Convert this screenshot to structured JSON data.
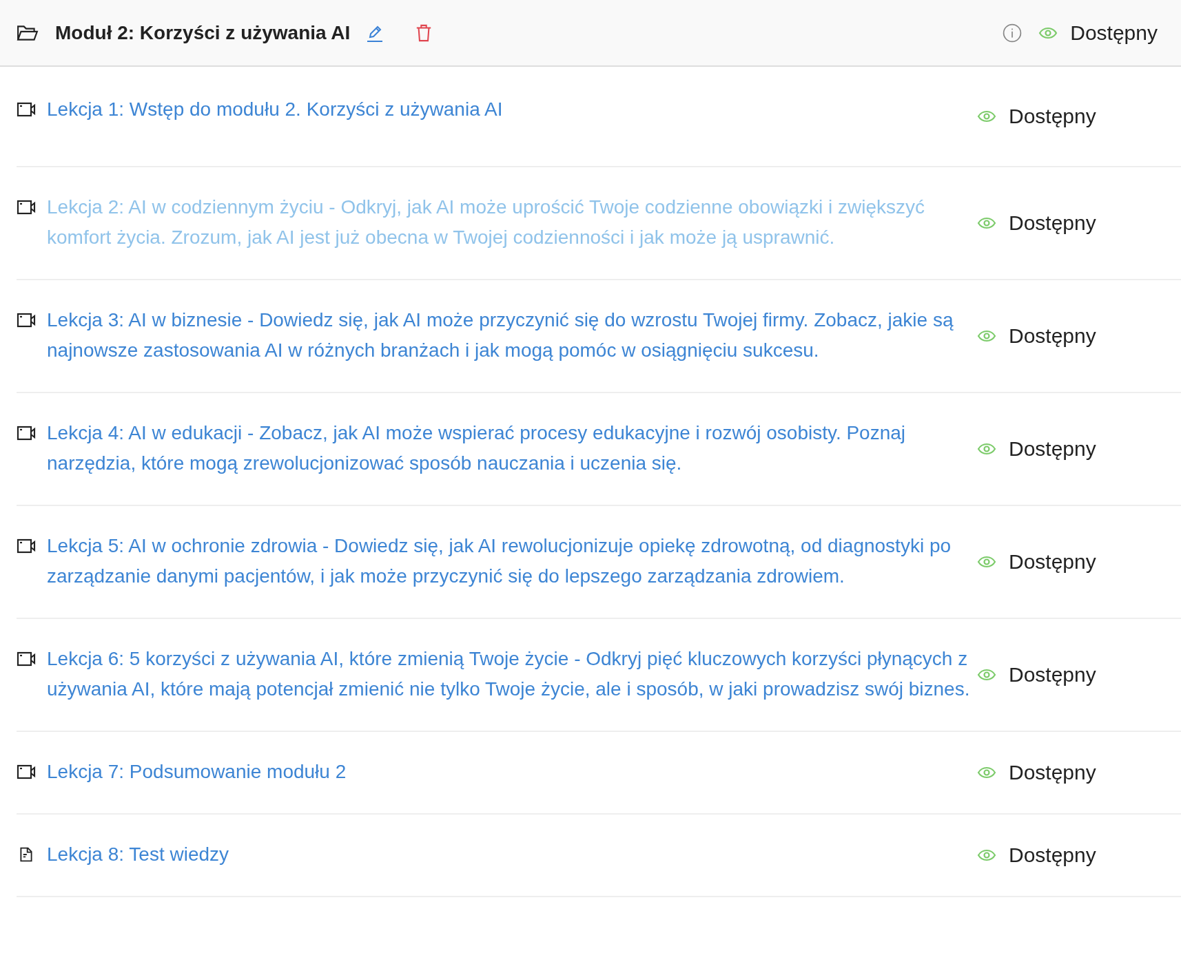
{
  "module": {
    "title": "Moduł 2: Korzyści z używania AI",
    "status": "Dostępny"
  },
  "lessons": [
    {
      "kind": "video",
      "title": "Lekcja 1: Wstęp do modułu 2. Korzyści z używania AI",
      "status": "Dostępny",
      "hovered": false
    },
    {
      "kind": "video",
      "title": "Lekcja 2: AI w codziennym życiu - Odkryj, jak AI może uprościć Twoje codzienne obowiązki i zwiększyć komfort życia. Zrozum, jak AI jest już obecna w Twojej codzienności i jak może ją usprawnić.",
      "status": "Dostępny",
      "hovered": true
    },
    {
      "kind": "video",
      "title": "Lekcja 3: AI w biznesie - Dowiedz się, jak AI może przyczynić się do wzrostu Twojej firmy. Zobacz, jakie są najnowsze zastosowania AI w różnych branżach i jak mogą pomóc w osiągnięciu sukcesu.",
      "status": "Dostępny",
      "hovered": false
    },
    {
      "kind": "video",
      "title": "Lekcja 4: AI w edukacji - Zobacz, jak AI może wspierać procesy edukacyjne i rozwój osobisty. Poznaj narzędzia, które mogą zrewolucjonizować sposób nauczania i uczenia się.",
      "status": "Dostępny",
      "hovered": false
    },
    {
      "kind": "video",
      "title": "Lekcja 5: AI w ochronie zdrowia - Dowiedz się, jak AI rewolucjonizuje opiekę zdrowotną, od diagnostyki po zarządzanie danymi pacjentów, i jak może przyczynić się do lepszego zarządzania zdrowiem.",
      "status": "Dostępny",
      "hovered": false
    },
    {
      "kind": "video",
      "title": "Lekcja 6: 5 korzyści z używania AI, które zmienią Twoje życie - Odkryj pięć kluczowych korzyści płynących z używania AI, które mają potencjał zmienić nie tylko Twoje życie, ale i sposób, w jaki prowadzisz swój biznes.",
      "status": "Dostępny",
      "hovered": false
    },
    {
      "kind": "video",
      "title": "Lekcja 7: Podsumowanie modułu 2",
      "status": "Dostępny",
      "hovered": false
    },
    {
      "kind": "document",
      "title": "Lekcja 8: Test wiedzy",
      "status": "Dostępny",
      "hovered": false
    }
  ]
}
